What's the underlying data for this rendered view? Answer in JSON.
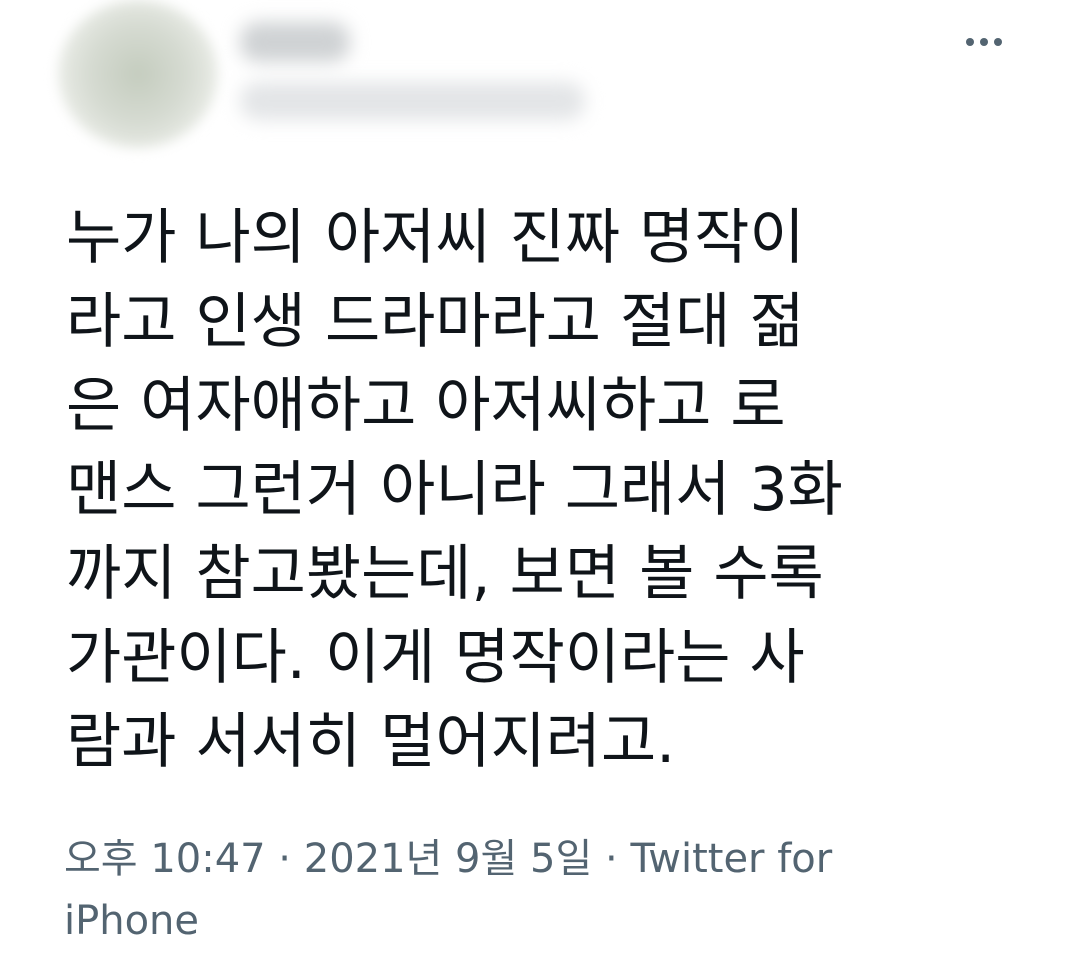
{
  "author": {
    "avatar": "blurred-avatar",
    "name": "",
    "handle": ""
  },
  "menu": {
    "icon": "more-horizontal-icon"
  },
  "tweet": {
    "lines": [
      "누가 나의 아저씨 진짜 명작이",
      "라고 인생 드라마라고 절대 젊",
      "은 여자애하고 아저씨하고 로",
      "맨스 그런거 아니라 그래서 3화",
      "까지 참고봤는데, 보면 볼 수록",
      "가관이다. 이게 명작이라는 사",
      "람과 서서히 멀어지려고."
    ]
  },
  "meta": {
    "time": "오후 10:47",
    "separator1": " · ",
    "date": "2021년 9월 5일",
    "separator2": " · ",
    "source_line1": "Twitter for",
    "source_line2": "iPhone"
  },
  "colors": {
    "text": "#0f1419",
    "secondary": "#536471",
    "background": "#ffffff"
  }
}
